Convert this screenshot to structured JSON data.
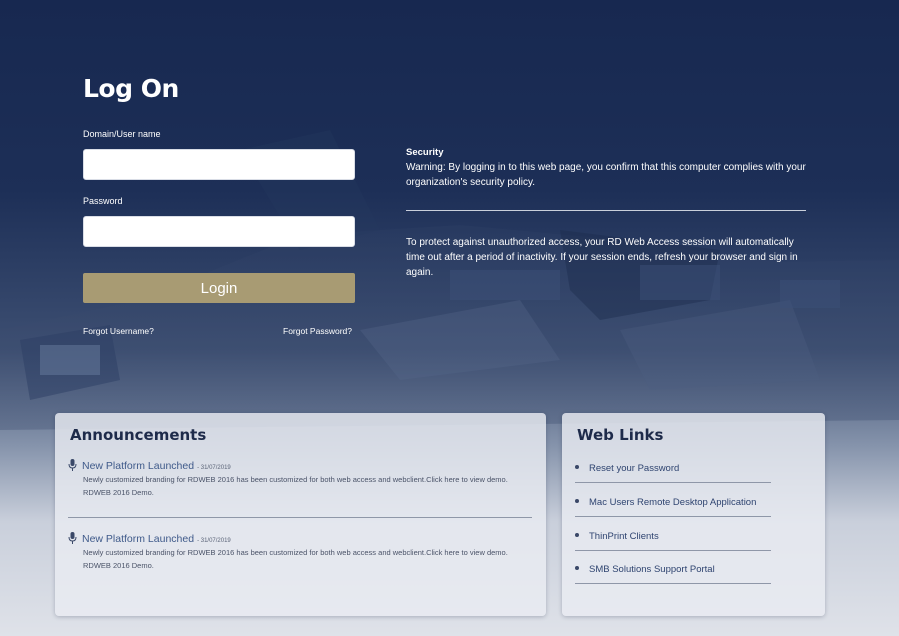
{
  "login": {
    "title": "Log On",
    "username_label": "Domain/User name",
    "username_value": "",
    "password_label": "Password",
    "password_value": "",
    "login_button": "Login",
    "forgot_username": "Forgot Username?",
    "forgot_password": "Forgot Password?"
  },
  "security": {
    "heading": "Security",
    "warning": "Warning: By logging in to this web page, you confirm that this computer complies with your organization's security policy.",
    "timeout_notice": "To protect against unauthorized access, your RD Web Access session will automatically time out after a period of inactivity. If your session ends, refresh your browser and sign in again."
  },
  "announcements": {
    "heading": "Announcements",
    "items": [
      {
        "icon": "microphone-icon",
        "title": "New Platform Launched",
        "date": "- 31/07/2019",
        "body": "Newly customized branding for RDWEB 2016 has been customized for both web access and webclient.Click here to view demo. RDWEB 2016 Demo."
      },
      {
        "icon": "microphone-icon",
        "title": "New Platform Launched",
        "date": "- 31/07/2019",
        "body": "Newly customized branding for RDWEB 2016 has been customized for both web access and webclient.Click here to view demo. RDWEB 2016 Demo."
      }
    ]
  },
  "weblinks": {
    "heading": "Web Links",
    "items": [
      {
        "label": "Reset your Password"
      },
      {
        "label": "Mac Users Remote Desktop Application"
      },
      {
        "label": "ThinPrint Clients"
      },
      {
        "label": "SMB Solutions Support Portal"
      }
    ]
  },
  "colors": {
    "background_navy": "#1d2f57",
    "login_button": "#a89b73",
    "panel_heading": "#1e2b4a",
    "link_text": "#2f4470"
  }
}
